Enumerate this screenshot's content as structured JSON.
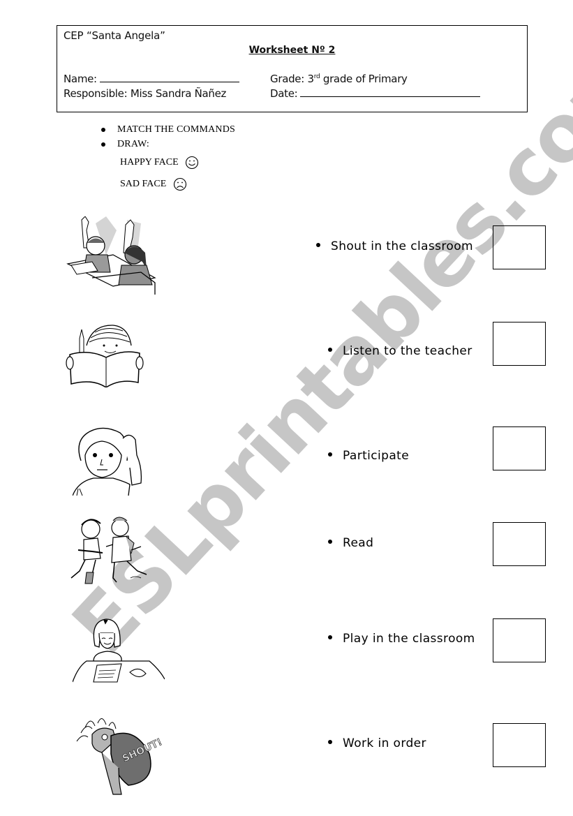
{
  "header": {
    "school": "CEP “Santa Angela”",
    "title": "Worksheet Nº 2",
    "name_label": "Name:",
    "responsible_label": "Responsible:",
    "responsible_value": "Miss Sandra Ñañez",
    "grade_label": "Grade:",
    "grade_value_num": "3",
    "grade_value_sup": "rd",
    "grade_value_rest": "grade of Primary",
    "date_label": "Date:"
  },
  "instructions": {
    "items": [
      "MATCH THE COMMANDS",
      "DRAW:"
    ],
    "happy_face_label": "HAPPY FACE",
    "sad_face_label": "SAD FACE",
    "happy_face_icon": "smiley-face-icon",
    "sad_face_icon": "frowning-face-icon"
  },
  "watermark": "ESLprintables.com",
  "pictures": [
    {
      "icon": "children-raising-hands-picture"
    },
    {
      "icon": "boy-reading-book-picture"
    },
    {
      "icon": "child-listening-picture"
    },
    {
      "icon": "children-playing-picture"
    },
    {
      "icon": "girl-writing-at-desk-picture"
    },
    {
      "icon": "person-shouting-picture"
    }
  ],
  "pictures_text": {
    "shout_bubble": "SHOUT!"
  },
  "commands": [
    "Shout in the classroom",
    "Listen to the teacher",
    "Participate",
    "Read",
    "Play in the classroom",
    "Work in order"
  ]
}
